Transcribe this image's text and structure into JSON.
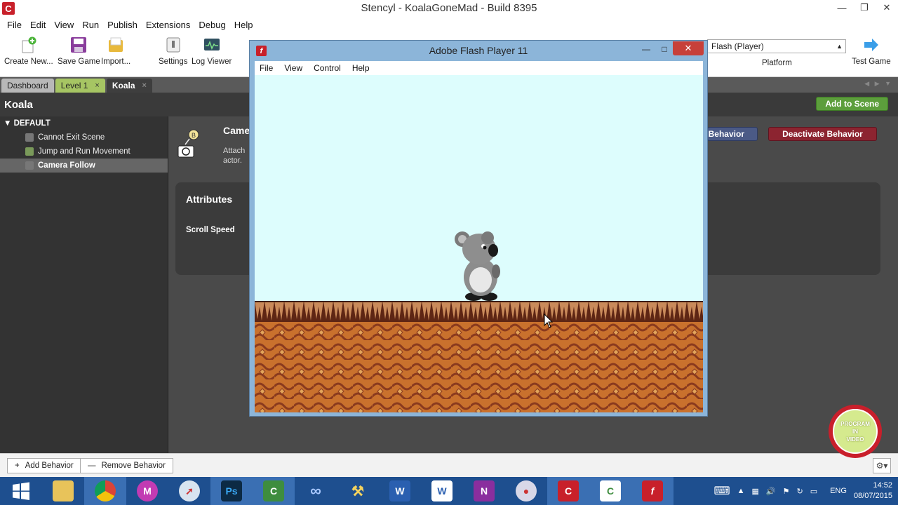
{
  "window": {
    "title": "Stencyl - KoalaGoneMad - Build 8395",
    "app_icon": "C"
  },
  "menu": [
    "File",
    "Edit",
    "View",
    "Run",
    "Publish",
    "Extensions",
    "Debug",
    "Help"
  ],
  "toolbar": {
    "create_new": "Create New...",
    "save_game": "Save Game",
    "import": "Import...",
    "settings": "Settings",
    "log_viewer": "Log Viewer",
    "platform_value": "Flash (Player)",
    "platform_label": "Platform",
    "test_game": "Test Game"
  },
  "tabs": {
    "dashboard": "Dashboard",
    "level": "Level 1",
    "koala": "Koala",
    "close": "×"
  },
  "header": {
    "actor_name": "Koala",
    "add_to_scene": "Add to Scene"
  },
  "sidebar": {
    "group": "DEFAULT",
    "items": [
      {
        "label": "Cannot Exit Scene"
      },
      {
        "label": "Jump and Run Movement"
      },
      {
        "label": "Camera Follow"
      }
    ]
  },
  "behavior": {
    "title": "Came",
    "desc_line1": "Attach",
    "desc_line2": "actor.",
    "edit_label": "Behavior",
    "deactivate_label": "Deactivate Behavior",
    "attributes_title": "Attributes",
    "scroll_speed_label": "Scroll Speed"
  },
  "bottom": {
    "add_behavior": "Add Behavior",
    "remove_behavior": "Remove Behavior"
  },
  "flash": {
    "title": "Adobe Flash Player 11",
    "menu": [
      "File",
      "View",
      "Control",
      "Help"
    ]
  },
  "taskbar": {
    "language": "ENG",
    "time": "14:52",
    "date": "08/07/2015"
  },
  "badge": {
    "line1": "PROGRAM",
    "line2": "IN",
    "line3": "VIDEO"
  },
  "colors": {
    "accent_green": "#5c9e3c",
    "deactivate_red": "#8c2430",
    "taskbar_blue": "#1e4f8f",
    "sky": "#ddfdfd"
  }
}
